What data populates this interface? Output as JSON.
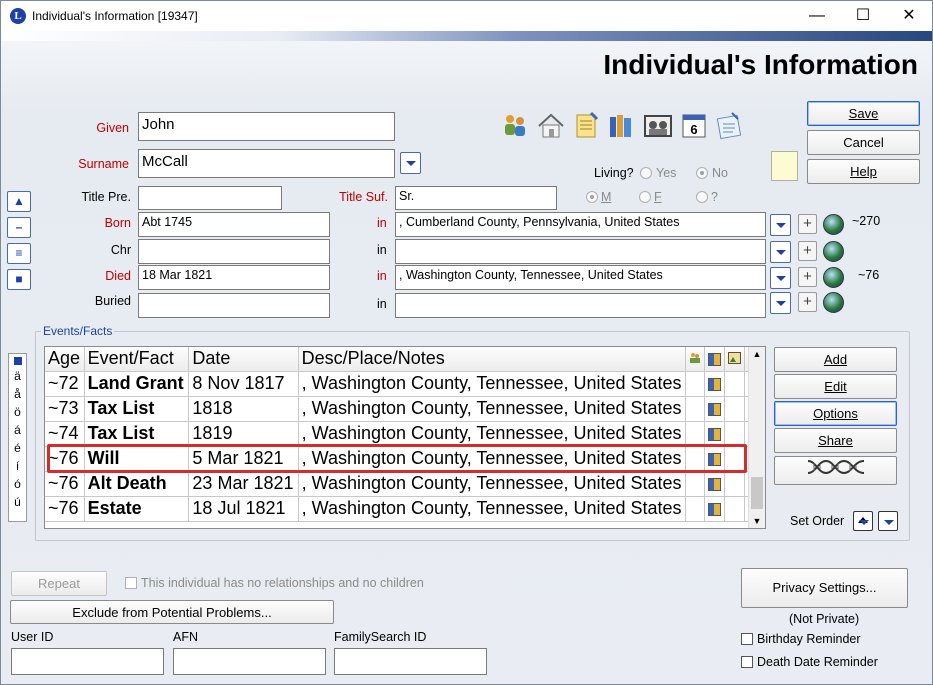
{
  "window": {
    "title": "Individual's Information  [19347]",
    "header_title": "Individual's Information"
  },
  "form": {
    "given_label": "Given",
    "given_value": "John",
    "surname_label": "Surname",
    "surname_value": "McCall",
    "title_pre_label": "Title Pre.",
    "title_pre_value": "",
    "title_suf_label": "Title Suf.",
    "title_suf_value": "Sr.",
    "living_label": "Living?",
    "living_yes": "Yes",
    "living_no": "No",
    "sex_m": "M",
    "sex_f": "F",
    "sex_unknown": "?",
    "in_label": "in",
    "born_label": "Born",
    "born_date": "Abt 1745",
    "born_place": ", Cumberland County, Pennsylvania, United States",
    "born_age": "~270",
    "chr_label": "Chr",
    "chr_date": "",
    "chr_place": "",
    "died_label": "Died",
    "died_date": "18 Mar 1821",
    "died_place": ", Washington County, Tennessee, United States",
    "died_age": "~76",
    "buried_label": "Buried",
    "buried_date": "",
    "buried_place": ""
  },
  "buttons": {
    "save": "Save",
    "cancel": "Cancel",
    "help": "Help",
    "add": "Add",
    "edit": "Edit",
    "options": "Options",
    "share": "Share",
    "set_order": "Set Order",
    "repeat": "Repeat",
    "exclude": "Exclude from Potential Problems...",
    "privacy": "Privacy Settings..."
  },
  "events": {
    "group_title": "Events/Facts",
    "columns": [
      "Age",
      "Event/Fact",
      "Date",
      "Desc/Place/Notes"
    ],
    "rows": [
      {
        "age": "~72",
        "event": "Land Grant",
        "date": "8 Nov 1817",
        "place": ", Washington County, Tennessee, United States"
      },
      {
        "age": "~73",
        "event": "Tax List",
        "date": "1818",
        "place": ", Washington County, Tennessee, United States"
      },
      {
        "age": "~74",
        "event": "Tax List",
        "date": "1819",
        "place": ", Washington County, Tennessee, United States"
      },
      {
        "age": "~76",
        "event": "Will",
        "date": "5 Mar 1821",
        "place": ", Washington County, Tennessee, United States"
      },
      {
        "age": "~76",
        "event": "Alt Death",
        "date": "23 Mar 1821",
        "place": ", Washington County, Tennessee, United States"
      },
      {
        "age": "~76",
        "event": "Estate",
        "date": "18 Jul 1821",
        "place": ", Washington County, Tennessee, United States"
      }
    ]
  },
  "accents": [
    "ä",
    "å",
    "ö",
    "á",
    "é",
    "í",
    "ó",
    "ú"
  ],
  "footer": {
    "no_relationships": "This individual has no relationships and no children",
    "user_id_label": "User ID",
    "afn_label": "AFN",
    "familysearch_label": "FamilySearch ID",
    "privacy_status": "(Not Private)",
    "birthday_reminder": "Birthday Reminder",
    "death_date_reminder": "Death Date Reminder"
  },
  "colors": {
    "required_label": "#c00000",
    "highlight_box": "#d52b2b",
    "accent_blue": "#1d3fa8"
  }
}
